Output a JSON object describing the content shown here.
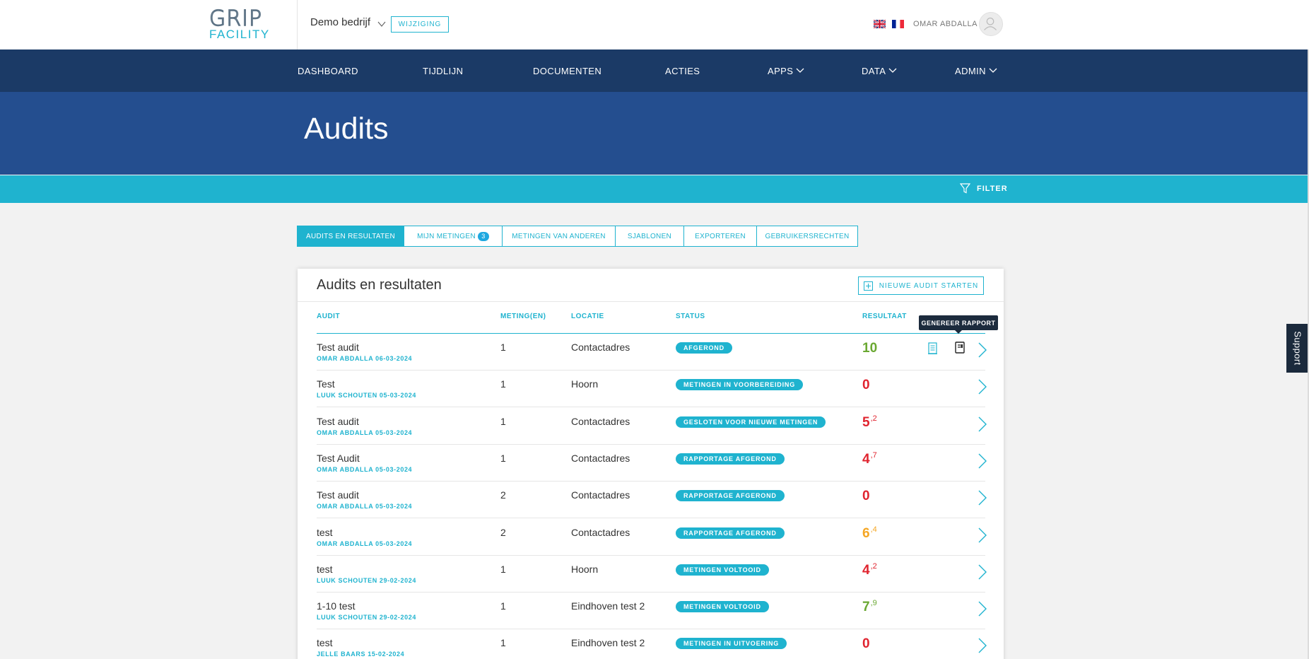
{
  "header": {
    "logo_line1": "GRIP",
    "logo_line2": "FACILITY",
    "company": "Demo bedrijf",
    "change_label": "WIJZIGING",
    "user": "OMAR ABDALLA"
  },
  "nav": {
    "items": [
      "DASHBOARD",
      "TIJDLIJN",
      "DOCUMENTEN",
      "ACTIES",
      "APPS",
      "DATA",
      "ADMIN"
    ]
  },
  "page": {
    "title": "Audits",
    "filter_label": "FILTER"
  },
  "tabs": [
    {
      "label": "AUDITS EN RESULTATEN",
      "active": true
    },
    {
      "label": "MIJN METINGEN",
      "badge": "3"
    },
    {
      "label": "METINGEN VAN ANDEREN"
    },
    {
      "label": "SJABLONEN"
    },
    {
      "label": "EXPORTEREN"
    },
    {
      "label": "GEBRUIKERSRECHTEN"
    }
  ],
  "card": {
    "title": "Audits en resultaten",
    "new_audit_label": "NIEUWE AUDIT STARTEN",
    "columns": {
      "audit": "AUDIT",
      "metingen": "METING(EN)",
      "locatie": "LOCATIE",
      "status": "STATUS",
      "resultaat": "RESULTAAT"
    },
    "tooltip": "GENEREER RAPPORT",
    "rows": [
      {
        "name": "Test audit",
        "sub": "OMAR ABDALLA 06-03-2024",
        "metingen": "1",
        "locatie": "Contactadres",
        "status": "AFGEROND",
        "res_main": "10",
        "res_dec": "",
        "res_color": "#6aa832"
      },
      {
        "name": "Test",
        "sub": "LUUK SCHOUTEN 05-03-2024",
        "metingen": "1",
        "locatie": "Hoorn",
        "status": "METINGEN IN VOORBEREIDING",
        "res_main": "0",
        "res_dec": "",
        "res_color": "#e0242f"
      },
      {
        "name": "Test audit",
        "sub": "OMAR ABDALLA 05-03-2024",
        "metingen": "1",
        "locatie": "Contactadres",
        "status": "GESLOTEN VOOR NIEUWE METINGEN",
        "res_main": "5",
        "res_dec": ",2",
        "res_color": "#e0242f"
      },
      {
        "name": "Test Audit",
        "sub": "OMAR ABDALLA 05-03-2024",
        "metingen": "1",
        "locatie": "Contactadres",
        "status": "RAPPORTAGE AFGEROND",
        "res_main": "4",
        "res_dec": ",7",
        "res_color": "#e0242f"
      },
      {
        "name": "Test audit",
        "sub": "OMAR ABDALLA 05-03-2024",
        "metingen": "2",
        "locatie": "Contactadres",
        "status": "RAPPORTAGE AFGEROND",
        "res_main": "0",
        "res_dec": "",
        "res_color": "#e0242f"
      },
      {
        "name": "test",
        "sub": "OMAR ABDALLA 05-03-2024",
        "metingen": "2",
        "locatie": "Contactadres",
        "status": "RAPPORTAGE AFGEROND",
        "res_main": "6",
        "res_dec": ",4",
        "res_color": "#f5a623"
      },
      {
        "name": "test",
        "sub": "LUUK SCHOUTEN 29-02-2024",
        "metingen": "1",
        "locatie": "Hoorn",
        "status": "METINGEN VOLTOOID",
        "res_main": "4",
        "res_dec": ",2",
        "res_color": "#e0242f"
      },
      {
        "name": "1-10 test",
        "sub": "LUUK SCHOUTEN 29-02-2024",
        "metingen": "1",
        "locatie": "Eindhoven test 2",
        "status": "METINGEN VOLTOOID",
        "res_main": "7",
        "res_dec": ",9",
        "res_color": "#6aa832"
      },
      {
        "name": "test",
        "sub": "JELLE BAARS 15-02-2024",
        "metingen": "1",
        "locatie": "Eindhoven test 2",
        "status": "METINGEN IN UITVOERING",
        "res_main": "0",
        "res_dec": "",
        "res_color": "#e0242f"
      }
    ]
  },
  "support_label": "Support",
  "colors": {
    "navy": "#1b3a66",
    "hero": "#244e8f",
    "accent": "#1fb3cf"
  }
}
